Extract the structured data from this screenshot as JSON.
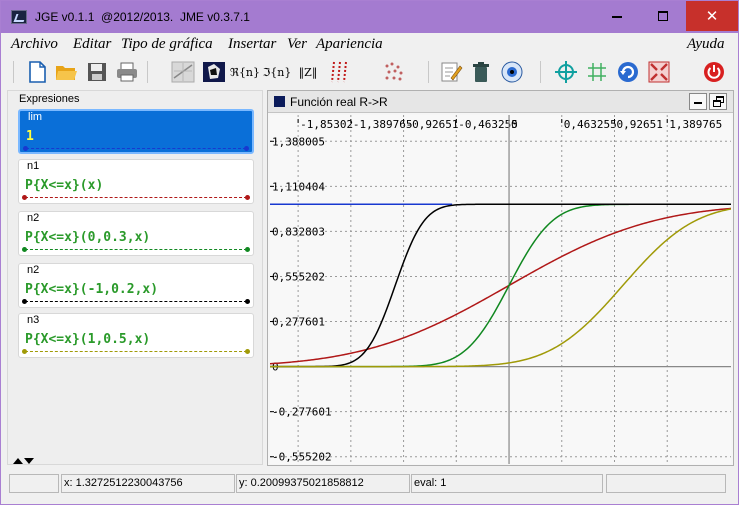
{
  "window": {
    "title": "JGE v0.1.1  @2012/2013.  JME v0.3.7.1",
    "colors": {
      "titlebar": "#a47bd0",
      "close": "#c7302b"
    }
  },
  "menu": {
    "items": [
      "Archivo",
      "Editar",
      "Tipo de gráfica",
      "Insertar",
      "Ver",
      "Apariencia"
    ],
    "help": "Ayuda"
  },
  "toolbar": {
    "buttons": [
      "new-file-icon",
      "open-folder-icon",
      "save-icon",
      "print-icon",
      "graph-2d-icon",
      "graph-3d-icon",
      "real-part-icon",
      "imaginary-part-icon",
      "modulus-icon",
      "roots-icon",
      "points-icon",
      "edit-icon",
      "trash-icon",
      "eye-icon",
      "crosshair-icon",
      "grid-icon",
      "refresh-icon",
      "fit-icon",
      "exit-icon"
    ],
    "labels": {
      "real": "ℜ{n}",
      "imag": "ℑ{n}",
      "abs": "‖Z‖"
    }
  },
  "expressions": {
    "header": "Expresiones",
    "items": [
      {
        "name": "lim",
        "formula": "1",
        "color": "#1838d0",
        "selected": true
      },
      {
        "name": "n1",
        "formula": "P{X<=x}(x)",
        "color": "#b01818",
        "selected": false
      },
      {
        "name": "n2",
        "formula": "P{X<=x}(0,0.3,x)",
        "color": "#108820",
        "selected": false
      },
      {
        "name": "n2",
        "formula": "P{X<=x}(-1,0.2,x)",
        "color": "#000000",
        "selected": false
      },
      {
        "name": "n3",
        "formula": "P{X<=x}(1,0.5,x)",
        "color": "#a09a08",
        "selected": false
      }
    ],
    "formula_color": "#2a9a2a",
    "selected_formula_color": "#ffff40"
  },
  "graph": {
    "title": "Función real R->R",
    "x_ticks": [
      "-1,85302",
      "-1,389765",
      "-0,92651",
      "-0,463255",
      "0",
      "0,463255",
      "0,92651",
      "1,389765"
    ],
    "y_ticks": [
      "1,388005",
      "1,110404",
      "0,832803",
      "0,555202",
      "0,277601",
      "0",
      "-0,277601",
      "-0,555202"
    ]
  },
  "chart_data": {
    "type": "line",
    "x_range": [
      -2.1,
      1.95
    ],
    "y_range": [
      -0.6,
      1.55
    ],
    "series": [
      {
        "color": "#1838d0",
        "kind": "constant",
        "value": 1,
        "x_end": -0.5
      },
      {
        "color": "#b01818",
        "kind": "normal_cdf",
        "mu": 0,
        "sigma": 1
      },
      {
        "color": "#108820",
        "kind": "normal_cdf",
        "mu": 0,
        "sigma": 0.3
      },
      {
        "color": "#000000",
        "kind": "normal_cdf",
        "mu": -1,
        "sigma": 0.2
      },
      {
        "color": "#a09a08",
        "kind": "normal_cdf",
        "mu": 1,
        "sigma": 0.5
      }
    ]
  },
  "status": {
    "x": "x: 1.3272512230043756",
    "y": "y: 0.20099375021858812",
    "eval": "eval: 1"
  }
}
